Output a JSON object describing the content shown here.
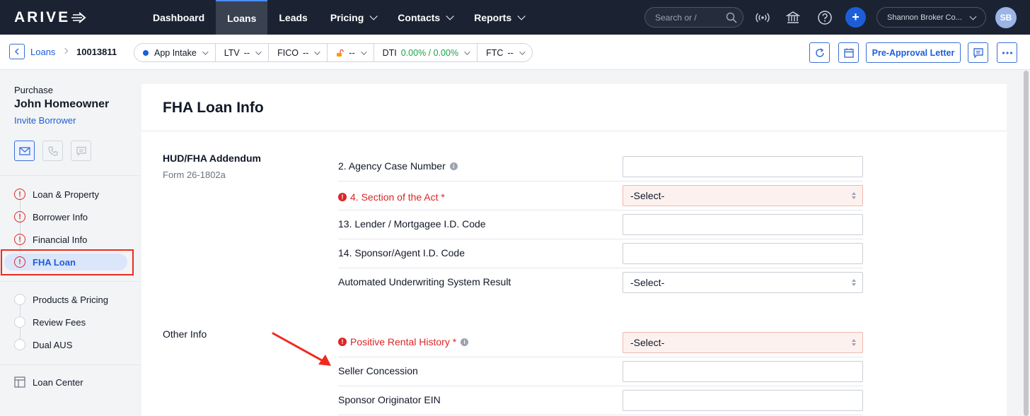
{
  "app": {
    "logo_text": "ARIVE",
    "nav": [
      {
        "label": "Dashboard"
      },
      {
        "label": "Loans"
      },
      {
        "label": "Leads"
      },
      {
        "label": "Pricing"
      },
      {
        "label": "Contacts"
      },
      {
        "label": "Reports"
      }
    ],
    "search_placeholder": "Search or /",
    "company": "Shannon Broker Co...",
    "avatar_initials": "SB",
    "plus_label": "+"
  },
  "breadcrumb": {
    "loans": "Loans",
    "loan_id": "10013811"
  },
  "status_bar": {
    "stage": "App Intake",
    "ltv_label": "LTV",
    "ltv_value": "--",
    "fico_label": "FICO",
    "fico_value": "--",
    "lock_value": "--",
    "dti_label": "DTI",
    "dti_value": "0.00% / 0.00%",
    "ftc_label": "FTC",
    "ftc_value": "--"
  },
  "actions": {
    "preapproval": "Pre-Approval Letter"
  },
  "sidebar": {
    "loan_type": "Purchase",
    "borrower": "John Homeowner",
    "invite": "Invite Borrower",
    "items": [
      {
        "label": "Loan & Property",
        "status": "error"
      },
      {
        "label": "Borrower Info",
        "status": "error"
      },
      {
        "label": "Financial Info",
        "status": "error"
      },
      {
        "label": "FHA Loan",
        "status": "error"
      },
      {
        "label": "Products & Pricing",
        "status": "empty"
      },
      {
        "label": "Review Fees",
        "status": "empty"
      },
      {
        "label": "Dual AUS",
        "status": "empty"
      },
      {
        "label": "Loan Center",
        "status": "icon"
      }
    ],
    "error_glyph": "!"
  },
  "main": {
    "title": "FHA Loan Info",
    "sections": [
      {
        "title": "HUD/FHA Addendum",
        "subtitle": "Form 26-1802a",
        "fields": [
          {
            "label": "2. Agency Case Number",
            "type": "input",
            "value": ""
          },
          {
            "label": "4. Section of the Act *",
            "type": "select",
            "value": "-Select-"
          },
          {
            "label": "13. Lender / Mortgagee I.D. Code",
            "type": "input",
            "value": ""
          },
          {
            "label": "14. Sponsor/Agent I.D. Code",
            "type": "input",
            "value": ""
          },
          {
            "label": "Automated Underwriting System Result",
            "type": "select",
            "value": "-Select-"
          }
        ]
      },
      {
        "title": "Other Info",
        "subtitle": "",
        "fields": [
          {
            "label": "Positive Rental History *",
            "type": "select",
            "value": "-Select-"
          },
          {
            "label": "Seller Concession",
            "type": "input",
            "value": ""
          },
          {
            "label": "Sponsor Originator EIN",
            "type": "input",
            "value": ""
          }
        ]
      }
    ],
    "info_glyph": "i",
    "error_glyph": "!"
  },
  "colors": {
    "nav_bg": "#1b2333",
    "accent": "#1d5ed8",
    "error": "#dc2626",
    "annotation": "#ef2a1f"
  }
}
